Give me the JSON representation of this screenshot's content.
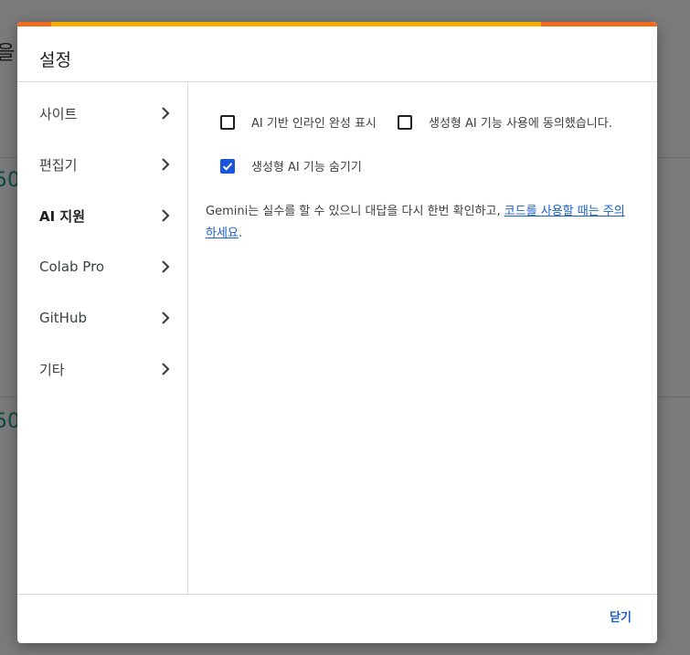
{
  "background": {
    "fragment_top": "을",
    "fragment_mid": "50",
    "fragment_low": "50"
  },
  "dialog": {
    "title": "설정",
    "accent_colors": [
      "#f26b1d",
      "#f9ab00",
      "#f26b1d"
    ]
  },
  "sidebar": {
    "items": [
      {
        "label": "사이트",
        "icon": "chevron-right-icon"
      },
      {
        "label": "편집기",
        "icon": "chevron-right-icon"
      },
      {
        "label": "AI 지원",
        "icon": "chevron-right-icon",
        "active": true
      },
      {
        "label": "Colab Pro",
        "icon": "chevron-right-icon"
      },
      {
        "label": "GitHub",
        "icon": "chevron-right-icon"
      },
      {
        "label": "기타",
        "icon": "chevron-right-icon"
      }
    ]
  },
  "ai_settings": {
    "inline_completion": {
      "label": "AI 기반 인라인 완성 표시",
      "checked": false
    },
    "consent": {
      "label": "생성형 AI 기능 사용에 동의했습니다.",
      "checked": false
    },
    "hide_ai": {
      "label": "생성형 AI 기능 숨기기",
      "checked": true
    },
    "disclaimer_text": "Gemini는 실수를 할 수 있으니 대답을 다시 한번 확인하고, ",
    "disclaimer_link": "코드를 사용할 때는 주의하세요",
    "disclaimer_end": "."
  },
  "footer": {
    "close_label": "닫기"
  },
  "colors": {
    "accent_blue": "#1a56db",
    "link_blue": "#1a5fd0"
  }
}
